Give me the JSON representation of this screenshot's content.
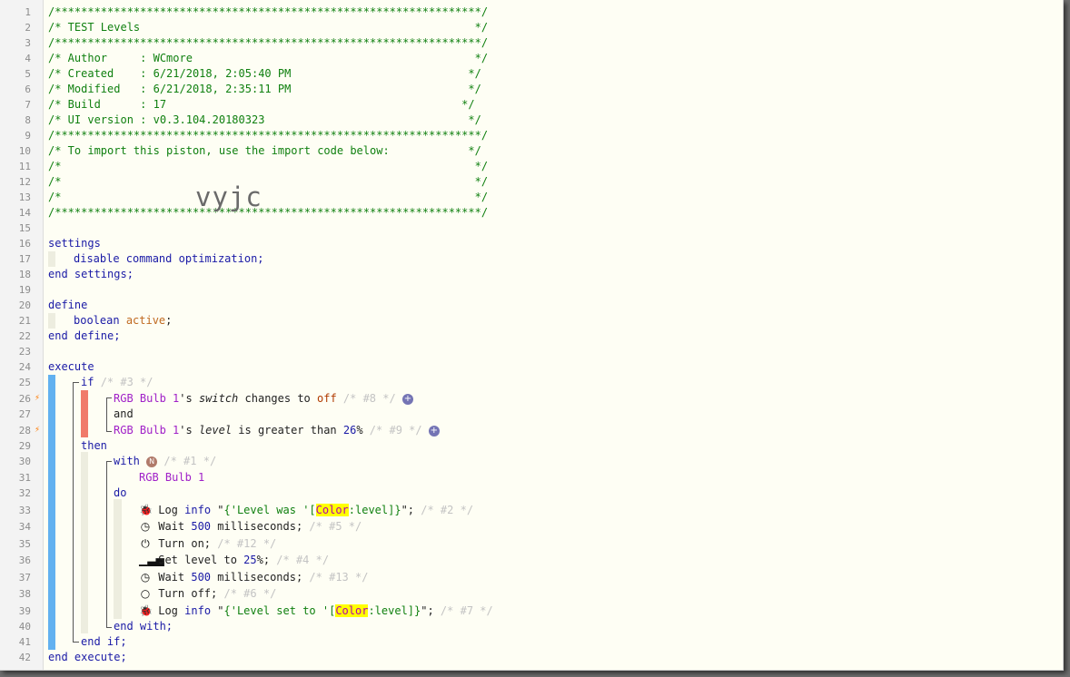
{
  "watermark": "vyjc",
  "line_numbers": [
    "1",
    "2",
    "3",
    "4",
    "5",
    "6",
    "7",
    "8",
    "9",
    "10",
    "11",
    "12",
    "13",
    "14",
    "15",
    "16",
    "17",
    "18",
    "19",
    "20",
    "21",
    "22",
    "23",
    "24",
    "25",
    "26",
    "27",
    "28",
    "29",
    "30",
    "31",
    "32",
    "33",
    "34",
    "35",
    "36",
    "37",
    "38",
    "39",
    "40",
    "41",
    "42"
  ],
  "header": {
    "border": "/*****************************************************************/",
    "title": "/* TEST Levels                                                   */",
    "author": "/* Author     : WCmore                                           */",
    "created": "/* Created    : 6/21/2018, 2:05:40 PM                           */",
    "modified": "/* Modified   : 6/21/2018, 2:35:11 PM                           */",
    "build": "/* Build      : 17                                             */",
    "ui_version": "/* UI version : v0.3.104.20180323                               */",
    "import_note": "/* To import this piston, use the import code below:            */",
    "empty": "/*                                                               */"
  },
  "settings": {
    "open": "settings",
    "item": "disable command optimization;",
    "close": "end settings;"
  },
  "define": {
    "open": "define",
    "type": "boolean",
    "var": "active",
    "semi": ";",
    "close": "end define;"
  },
  "execute": {
    "open": "execute",
    "if_kw": "if",
    "if_cmt": "/* #3 */",
    "cond1": {
      "device": "RGB Bulb 1",
      "poss": "'s ",
      "attr": "switch",
      "op": " changes to ",
      "val": "off",
      "cmt": " /* #8 */ "
    },
    "and": "and",
    "cond2": {
      "device": "RGB Bulb 1",
      "poss": "'s ",
      "attr": "level",
      "op": " is greater than ",
      "val": "26",
      "unit": "%",
      "cmt": " /* #9 */ "
    },
    "then": "then",
    "with_kw": "with",
    "with_badge": "N",
    "with_cmt": "/* #1 */",
    "with_device": "RGB Bulb 1",
    "do": "do",
    "end_with": "end with;",
    "end_if": "end if;",
    "close": "end execute;",
    "plus": "+",
    "actions": {
      "log1": {
        "icon": "bug-icon",
        "verb": "Log ",
        "level": "info",
        "q1": " \"",
        "str1": "{'Level was '[",
        "hl": "Color",
        "str2": ":level]}",
        "q2": "\";",
        "cmt": " /* #2 */"
      },
      "wait1": {
        "icon": "clock-icon",
        "text": "Wait ",
        "num": "500",
        "unit": " milliseconds;",
        "cmt": " /* #5 */"
      },
      "turn_on": {
        "icon": "power-icon",
        "text": "Turn on;",
        "cmt": " /* #12 */"
      },
      "set_level": {
        "icon": "signal-icon",
        "text": "Set level to ",
        "num": "25",
        "unit": "%;",
        "cmt": " /* #4 */"
      },
      "wait2": {
        "icon": "clock-icon",
        "text": "Wait ",
        "num": "500",
        "unit": " milliseconds;",
        "cmt": " /* #13 */"
      },
      "turn_off": {
        "icon": "circle-off-icon",
        "text": "Turn off;",
        "cmt": " /* #6 */"
      },
      "log2": {
        "icon": "bug-icon",
        "verb": "Log ",
        "level": "info",
        "q1": " \"",
        "str1": "{'Level set to '[",
        "hl": "Color",
        "str2": ":level]}",
        "q2": "\";",
        "cmt": " /* #7 */"
      }
    }
  },
  "colors": {
    "comment": "#108010",
    "keyword": "#1a1aa6",
    "device": "#a020c8",
    "highlight": "#ffff00",
    "trigger_bar": "#f07a6a",
    "block_bar": "#62b1f0",
    "trigger_bolt": "#ff7a00"
  }
}
